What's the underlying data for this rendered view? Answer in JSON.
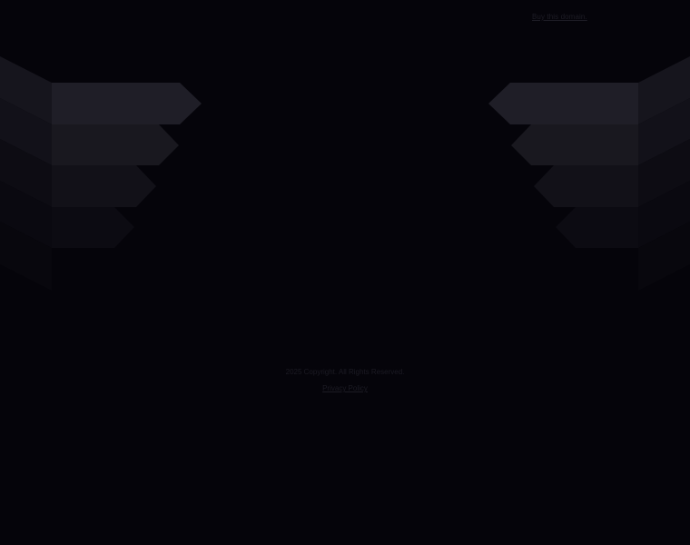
{
  "header": {
    "buy_domain_label": "Buy this domain."
  },
  "footer": {
    "copyright_text": "2025 Copyright. All Rights Reserved.",
    "privacy_label": "Privacy Policy"
  },
  "colors": {
    "background": "#05040a",
    "wing_light": "#1f1e27",
    "wing_mid": "#17161f",
    "wing_dark": "#0f0e16",
    "wing_darkest": "#0a0910",
    "muted_text": "#1c1b24"
  }
}
